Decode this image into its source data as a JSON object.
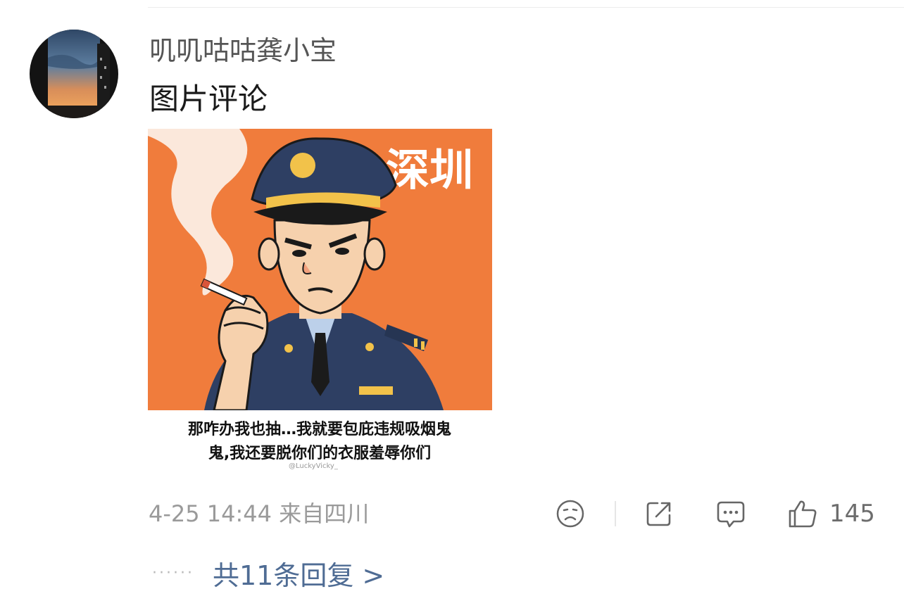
{
  "comment": {
    "username": "叽叽咕咕龚小宝",
    "text": "图片评论",
    "image": {
      "corner_text": "深圳",
      "caption_line1": "那咋办我也抽…我就要包庇违规吸烟鬼",
      "caption_line2": "鬼,我还要脱你们的衣服羞辱你们",
      "watermark": "@LuckyVicky_",
      "colors": {
        "background": "#f07c3c",
        "uniform": "#2e3f63",
        "badge": "#f2c24a"
      }
    },
    "meta": "4-25 14:44 来自四川",
    "like_count": "145",
    "replies_dots": "······",
    "replies_link": "共11条回复 >",
    "icons": [
      "dislike-face-icon",
      "share-icon",
      "comment-icon",
      "thumbs-up-icon"
    ]
  }
}
